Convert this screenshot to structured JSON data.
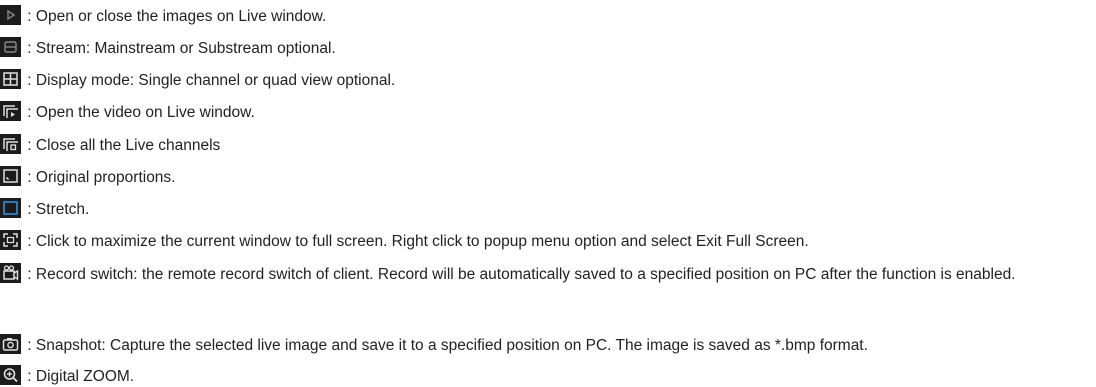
{
  "items": [
    {
      "icon": "play-icon",
      "text": " : Open or close the images on Live window."
    },
    {
      "icon": "stream-icon",
      "text": " : Stream: Mainstream or Substream optional."
    },
    {
      "icon": "display-mode-icon",
      "text": " : Display mode: Single channel or quad view optional."
    },
    {
      "icon": "open-video-icon",
      "text": " : Open the video on Live window."
    },
    {
      "icon": "close-all-channels-icon",
      "text": " : Close all the Live channels"
    },
    {
      "icon": "original-proportions-icon",
      "text": " : Original proportions."
    },
    {
      "icon": "stretch-icon",
      "text": " : Stretch."
    },
    {
      "icon": "fullscreen-icon",
      "text": " : Click to maximize the current window to full screen. Right click to popup menu option and select Exit Full Screen."
    },
    {
      "icon": "record-icon",
      "text": " : Record switch: the remote record switch of client. Record will be automatically saved to a specified position on PC after the function is enabled."
    },
    {
      "icon": "snapshot-icon",
      "text": " : Snapshot: Capture the selected live image and save it to a specified position on PC. The image is saved as *.bmp format."
    },
    {
      "icon": "zoom-in-icon",
      "text": " : Digital ZOOM."
    }
  ],
  "colors": {
    "icon_bg": "#1c1c1c",
    "icon_fg": "#dddddd",
    "accent": "#2f8fd8",
    "text": "#222222"
  }
}
